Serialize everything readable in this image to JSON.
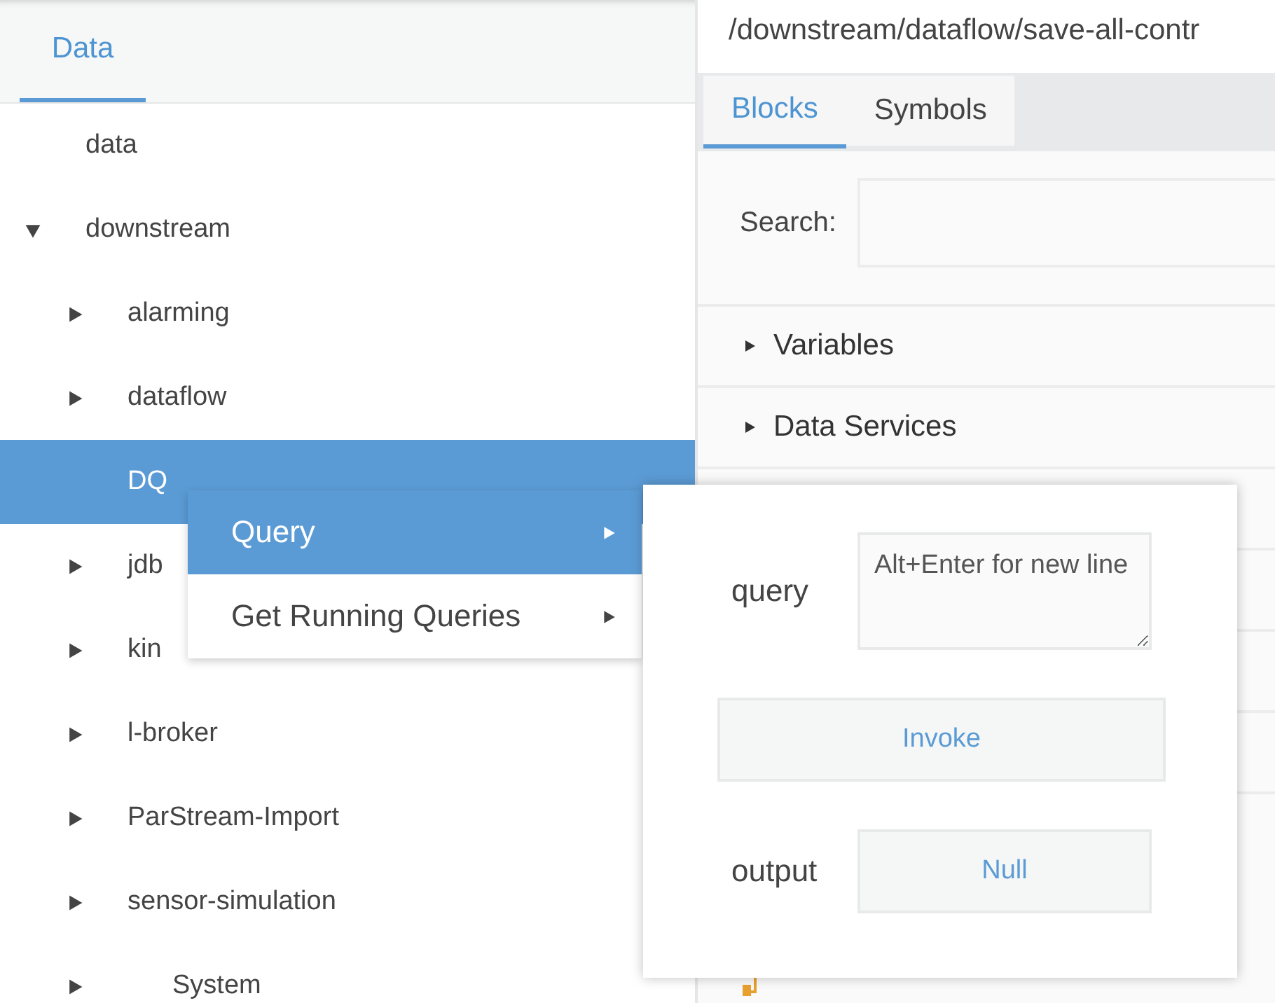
{
  "left_panel": {
    "tabs": [
      {
        "label": "Data",
        "selected": true
      }
    ],
    "tree": [
      {
        "label": "data",
        "expandable": false,
        "selected": false
      },
      {
        "label": "downstream",
        "expandable": true,
        "expanded": true,
        "selected": false,
        "children": [
          {
            "label": "alarming",
            "expandable": true,
            "expanded": false,
            "selected": false
          },
          {
            "label": "dataflow",
            "expandable": true,
            "expanded": false,
            "selected": false
          },
          {
            "label": "DQ",
            "expandable": false,
            "selected": true
          },
          {
            "label": "jdb",
            "expandable": true,
            "expanded": false,
            "selected": false
          },
          {
            "label": "kin",
            "expandable": true,
            "expanded": false,
            "selected": false
          },
          {
            "label": "l-broker",
            "expandable": true,
            "expanded": false,
            "selected": false
          },
          {
            "label": "ParStream-Import",
            "expandable": true,
            "expanded": false,
            "selected": false
          },
          {
            "label": "sensor-simulation",
            "expandable": true,
            "expanded": false,
            "selected": false
          },
          {
            "label": "System",
            "expandable": true,
            "expanded": false,
            "selected": false,
            "indented": true
          }
        ]
      }
    ]
  },
  "right_panel": {
    "path": "/downstream/dataflow/save-all-contr",
    "tabs": [
      {
        "label": "Blocks",
        "selected": true
      },
      {
        "label": "Symbols",
        "selected": false
      }
    ],
    "search": {
      "label": "Search:"
    },
    "sections": [
      {
        "label": "Variables",
        "expanded": false
      },
      {
        "label": "Data Services",
        "expanded": false
      }
    ]
  },
  "context_menu": {
    "items": [
      {
        "label": "Query",
        "selected": true,
        "has_submenu": true
      },
      {
        "label": "Get Running Queries",
        "selected": false,
        "has_submenu": true
      }
    ]
  },
  "action_popup": {
    "query_label": "query",
    "query_placeholder": "Alt+Enter for new line",
    "invoke_button": "Invoke",
    "output_label": "output",
    "output_value": "Null"
  }
}
